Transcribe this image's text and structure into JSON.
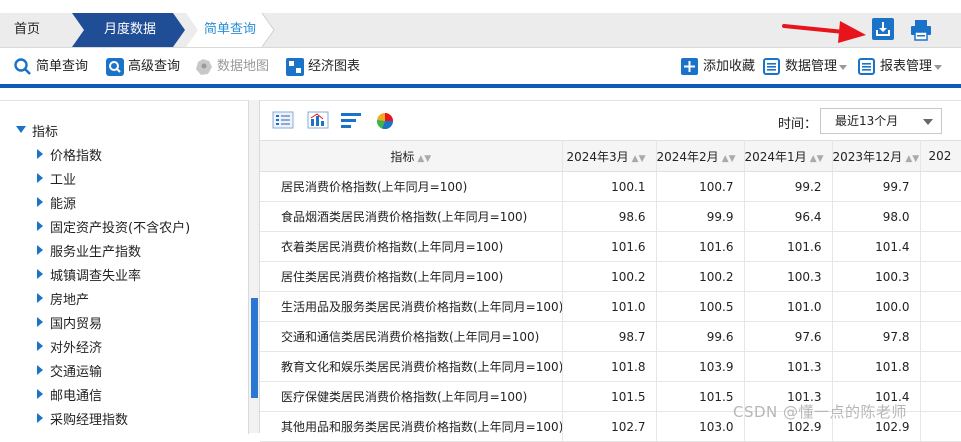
{
  "breadcrumb": {
    "home": "首页",
    "monthly": "月度数据",
    "simple_query": "简单查询"
  },
  "toolbar": {
    "simple_query": "简单查询",
    "advanced_query": "高级查询",
    "data_map": "数据地图",
    "econ_chart": "经济图表",
    "add_favorite": "添加收藏",
    "data_manage": "数据管理",
    "report_manage": "报表管理"
  },
  "tree": {
    "root": "指标",
    "items": [
      {
        "label": "价格指数"
      },
      {
        "label": "工业"
      },
      {
        "label": "能源"
      },
      {
        "label": "固定资产投资(不含农户)"
      },
      {
        "label": "服务业生产指数"
      },
      {
        "label": "城镇调查失业率"
      },
      {
        "label": "房地产"
      },
      {
        "label": "国内贸易"
      },
      {
        "label": "对外经济"
      },
      {
        "label": "交通运输"
      },
      {
        "label": "邮电通信"
      },
      {
        "label": "采购经理指数"
      }
    ]
  },
  "time_filter": {
    "label": "时间：",
    "value": "最近13个月"
  },
  "table": {
    "headers": [
      "指标",
      "2024年3月",
      "2024年2月",
      "2024年1月",
      "2023年12月",
      "202"
    ],
    "rows": [
      {
        "name": "居民消费价格指数(上年同月=100)",
        "values": [
          "100.1",
          "100.7",
          "99.2",
          "99.7"
        ]
      },
      {
        "name": "食品烟酒类居民消费价格指数(上年同月=100)",
        "values": [
          "98.6",
          "99.9",
          "96.4",
          "98.0"
        ]
      },
      {
        "name": "衣着类居民消费价格指数(上年同月=100)",
        "values": [
          "101.6",
          "101.6",
          "101.6",
          "101.4"
        ]
      },
      {
        "name": "居住类居民消费价格指数(上年同月=100)",
        "values": [
          "100.2",
          "100.2",
          "100.3",
          "100.3"
        ]
      },
      {
        "name": "生活用品及服务类居民消费价格指数(上年同月=100)",
        "values": [
          "101.0",
          "100.5",
          "101.0",
          "100.0"
        ]
      },
      {
        "name": "交通和通信类居民消费价格指数(上年同月=100)",
        "values": [
          "98.7",
          "99.6",
          "97.6",
          "97.8"
        ]
      },
      {
        "name": "教育文化和娱乐类居民消费价格指数(上年同月=100)",
        "values": [
          "101.8",
          "103.9",
          "101.3",
          "101.8"
        ]
      },
      {
        "name": "医疗保健类居民消费价格指数(上年同月=100)",
        "values": [
          "101.5",
          "101.5",
          "101.3",
          "101.4"
        ]
      },
      {
        "name": "其他用品和服务类居民消费价格指数(上年同月=100)",
        "values": [
          "102.7",
          "103.0",
          "102.9",
          "102.9"
        ]
      }
    ]
  },
  "watermark": "CSDN @懂一点的陈老师",
  "colors": {
    "brand_blue": "#0f5ab7",
    "crumb_active": "#1f4e96",
    "accent_red": "#e8141b"
  },
  "icons": [
    "download-icon",
    "printer-icon",
    "search-icon",
    "advanced-search-icon",
    "map-icon",
    "chart-icon",
    "plus-icon",
    "list-icon",
    "table-view-icon",
    "bar-chart-icon",
    "text-view-icon",
    "pie-chart-icon"
  ]
}
